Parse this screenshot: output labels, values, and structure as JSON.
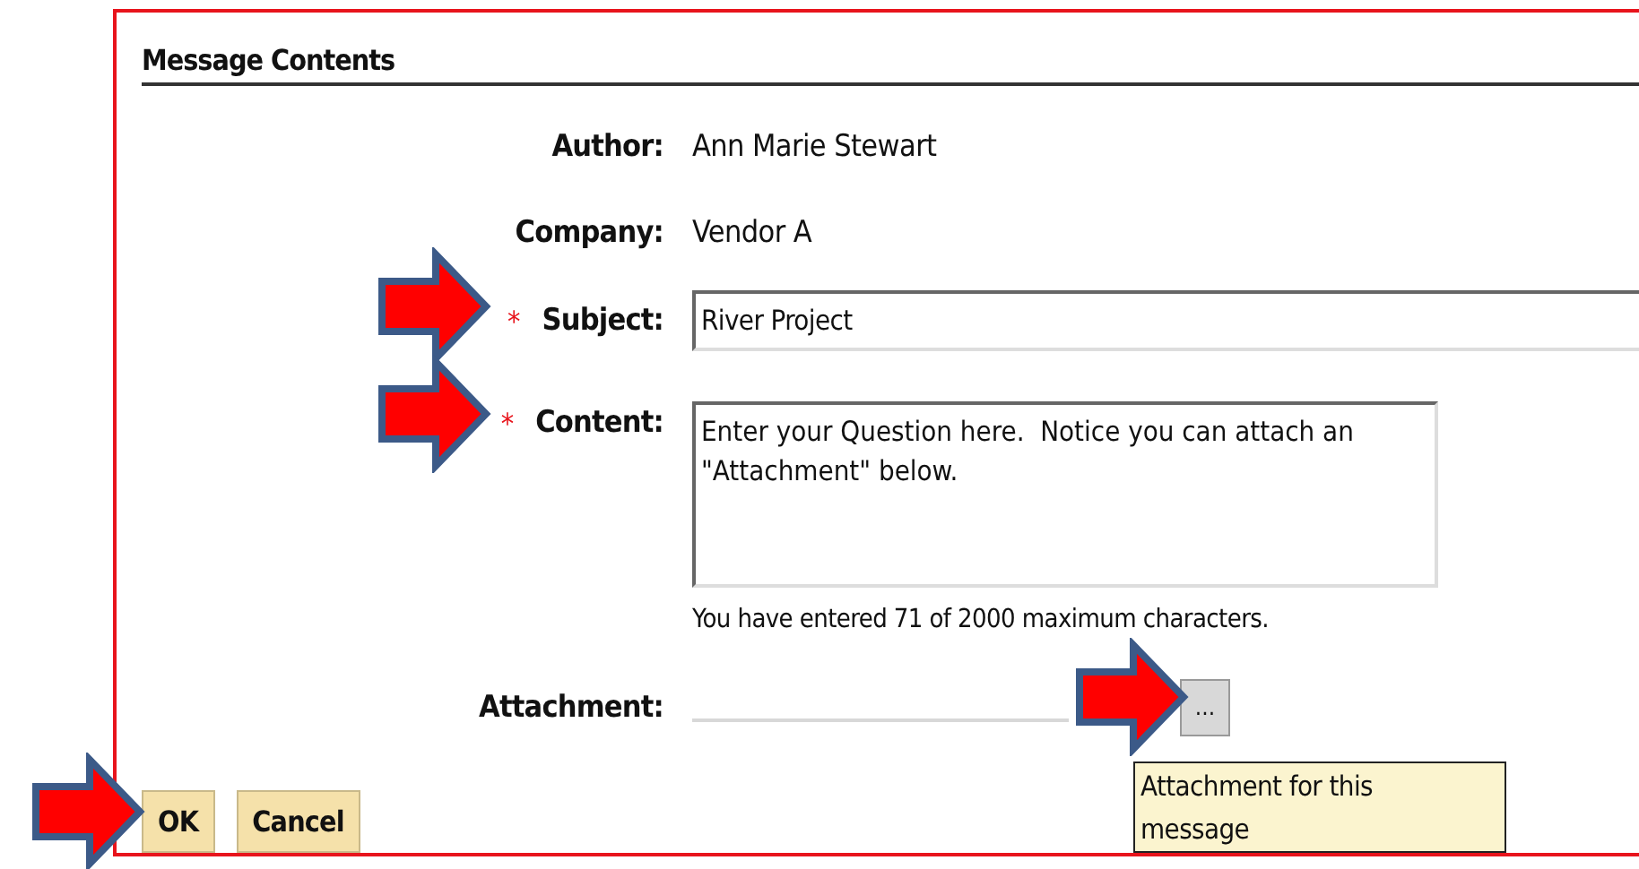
{
  "section": {
    "title": "Message Contents"
  },
  "fields": [
    {
      "kind": "info",
      "label": "Author:",
      "value": "Ann Marie Stewart"
    },
    {
      "kind": "info",
      "label": "Company:",
      "value": "Vendor A"
    },
    {
      "kind": "text",
      "label": "Subject:",
      "required_mark": "*",
      "value": "River Project"
    },
    {
      "kind": "textarea",
      "label": "Content:",
      "required_mark": "*",
      "value": "Enter your Question here.  Notice you can attach an \"Attachment\" below.",
      "counter": "You have entered 71 of 2000 maximum characters."
    },
    {
      "kind": "file",
      "label": "Attachment:",
      "button": "...",
      "tooltip": "Attachment for this message"
    }
  ],
  "buttons": [
    "OK",
    "Cancel"
  ]
}
